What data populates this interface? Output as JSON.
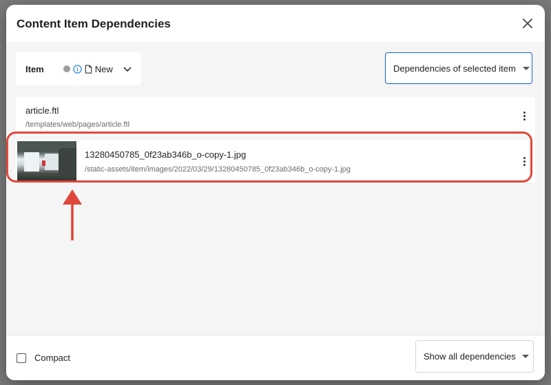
{
  "dialog": {
    "title": "Content Item Dependencies"
  },
  "toolbar": {
    "item_label": "Item",
    "item_name": "New",
    "dependency_mode": "Dependencies of selected item"
  },
  "dependencies": [
    {
      "name": "article.ftl",
      "path": "/templates/web/pages/article.ftl",
      "has_thumbnail": false
    },
    {
      "name": "13280450785_0f23ab346b_o-copy-1.jpg",
      "path": "/static-assets/item/images/2022/03/29/13280450785_0f23ab346b_o-copy-1.jpg",
      "has_thumbnail": true
    }
  ],
  "footer": {
    "compact_label": "Compact",
    "compact_checked": false,
    "show_filter": "Show all dependencies"
  },
  "colors": {
    "accent": "#1565c0",
    "highlight": "#e0473b",
    "state_dot": "#9e9e9e"
  },
  "icons": {
    "close": "close-icon",
    "info": "info-icon",
    "document": "document-icon",
    "chevron": "chevron-down-icon",
    "menu": "more-vert-icon"
  }
}
